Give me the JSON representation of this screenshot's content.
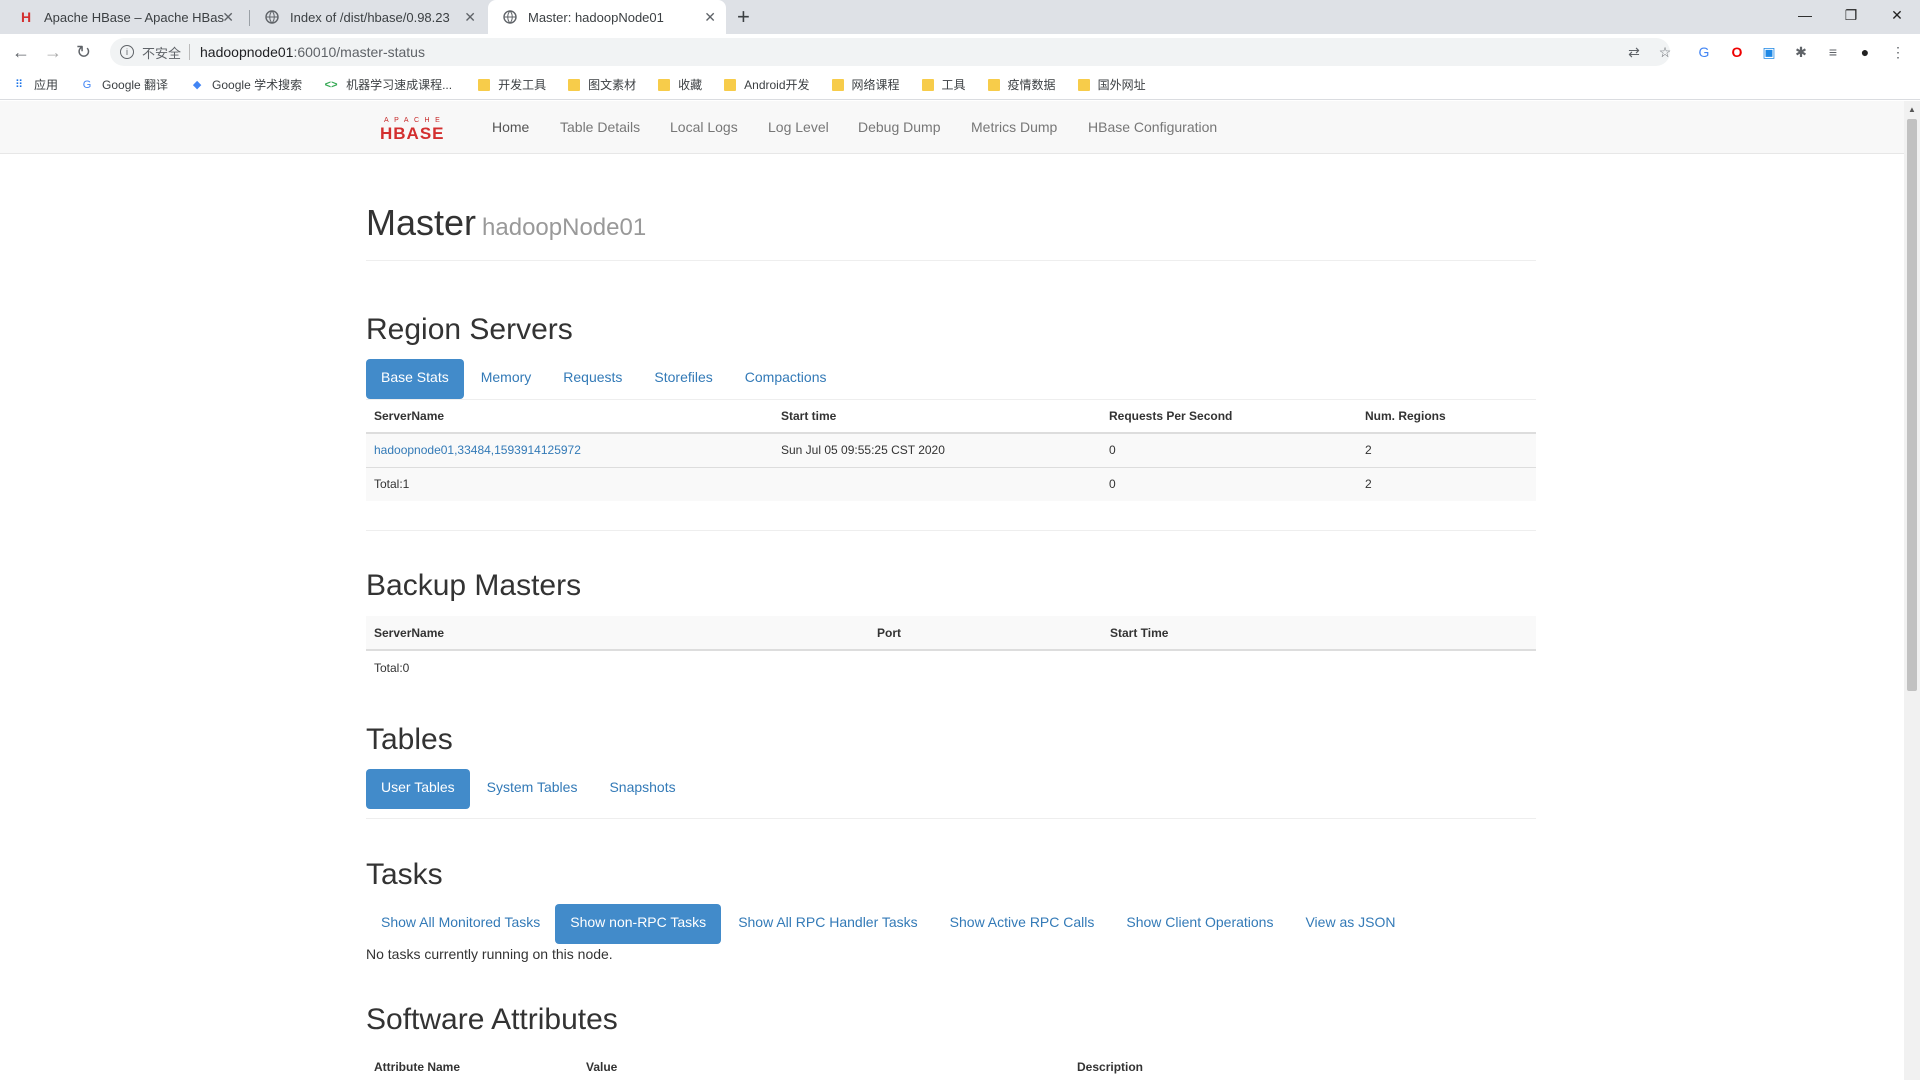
{
  "browser": {
    "tabs": [
      {
        "title": "Apache HBase – Apache HBase",
        "icon": "hbase-icon"
      },
      {
        "title": "Index of /dist/hbase/0.98.23",
        "icon": "globe-icon"
      },
      {
        "title": "Master: hadoopNode01",
        "icon": "globe-icon"
      }
    ],
    "insecure_label": "不安全",
    "url_host": "hadoopnode01",
    "url_path": ":60010/master-status",
    "bookmarks": [
      {
        "label": "应用",
        "icon": "apps-grid-icon"
      },
      {
        "label": "Google 翻译",
        "icon": "google-translate-icon"
      },
      {
        "label": "Google 学术搜索",
        "icon": "google-scholar-icon"
      },
      {
        "label": "机器学习速成课程...",
        "icon": "code-icon"
      },
      {
        "label": "开发工具",
        "icon": "folder-icon"
      },
      {
        "label": "图文素材",
        "icon": "folder-icon"
      },
      {
        "label": "收藏",
        "icon": "folder-icon"
      },
      {
        "label": "Android开发",
        "icon": "folder-icon"
      },
      {
        "label": "网络课程",
        "icon": "folder-icon"
      },
      {
        "label": "工具",
        "icon": "folder-icon"
      },
      {
        "label": "疫情数据",
        "icon": "folder-icon"
      },
      {
        "label": "国外网址",
        "icon": "folder-icon"
      }
    ]
  },
  "navbar": {
    "links": [
      "Home",
      "Table Details",
      "Local Logs",
      "Log Level",
      "Debug Dump",
      "Metrics Dump",
      "HBase Configuration"
    ]
  },
  "header": {
    "title": "Master",
    "subtitle": "hadoopNode01"
  },
  "region_servers": {
    "heading": "Region Servers",
    "tabs": [
      "Base Stats",
      "Memory",
      "Requests",
      "Storefiles",
      "Compactions"
    ],
    "columns": [
      "ServerName",
      "Start time",
      "Requests Per Second",
      "Num. Regions"
    ],
    "rows": [
      [
        "hadoopnode01,33484,1593914125972",
        "Sun Jul 05 09:55:25 CST 2020",
        "0",
        "2"
      ],
      [
        "Total:1",
        "",
        "0",
        "2"
      ]
    ]
  },
  "backup_masters": {
    "heading": "Backup Masters",
    "columns": [
      "ServerName",
      "Port",
      "Start Time"
    ],
    "total": "Total:0"
  },
  "tables": {
    "heading": "Tables",
    "tabs": [
      "User Tables",
      "System Tables",
      "Snapshots"
    ]
  },
  "tasks": {
    "heading": "Tasks",
    "tabs": [
      "Show All Monitored Tasks",
      "Show non-RPC Tasks",
      "Show All RPC Handler Tasks",
      "Show Active RPC Calls",
      "Show Client Operations",
      "View as JSON"
    ],
    "empty_message": "No tasks currently running on this node."
  },
  "software_attributes": {
    "heading": "Software Attributes",
    "columns": [
      "Attribute Name",
      "Value",
      "Description"
    ]
  },
  "colors": {
    "link": "#337ab7",
    "pill_active": "#428bca"
  }
}
